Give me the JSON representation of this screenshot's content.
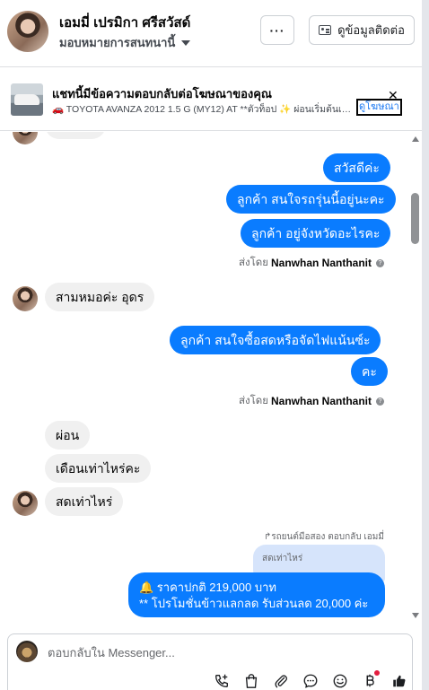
{
  "header": {
    "contact_name": "เอมมี่ เปรมิกา ศรีสวัสด์",
    "assign_label": "มอบหมายการสนทนานี้",
    "more_label": "···",
    "contact_info_label": "ดูข้อมูลติดต่อ"
  },
  "ad": {
    "title": "แชทนี้มีข้อความตอบกลับต่อโฆษณาของคุณ",
    "subtitle": "🚗 TOYOTA AVANZA 2012 1.5 G (MY12) AT **ตัวท็อป ✨ ผ่อนเริ่มต้นเพ็...",
    "view_ad_label": "ดูโฆษณา",
    "close_label": "✕"
  },
  "messages": {
    "m1": "สวัสดีค่ะ",
    "m2": "ลูกค้า สนใจรถรุ่นนี้อยู่นะคะ",
    "m3": "ลูกค้า อยู่จังหวัดอะไรคะ",
    "sent_by_1_prefix": "ส่งโดย",
    "sent_by_1_name": "Nanwhan Nanthanit",
    "m4": "สามหมอค่ะ อุดร",
    "m5": "ลูกค้า สนใจซื้อสดหรือจัดไฟแน้นซ์ะ",
    "m6": "คะ",
    "sent_by_2_prefix": "ส่งโดย",
    "sent_by_2_name": "Nanwhan Nanthanit",
    "m7": "ผ่อน",
    "m8": "เดือนเท่าไหร่คะ",
    "m9": "สดเท่าไหร่",
    "reply_hint": "↱รถยนต์มือสอง ตอบกลับ เอมมี่",
    "quoted_text": "สดเท่าไหร่",
    "m10_line1": "🔔 ราคาปกติ 219,000 บาท",
    "m10_line2": "** โปรโมชั่นข้าวแลกลด รับส่วนลด 20,000 ค่ะ"
  },
  "composer": {
    "placeholder": "ตอบกลับใน Messenger..."
  },
  "icons": [
    "call-add-icon",
    "shopping-bag-icon",
    "paperclip-icon",
    "chat-bubble-icon",
    "emoji-icon",
    "baht-payment-icon",
    "thumbs-up-icon"
  ],
  "colors": {
    "outgoing_bubble": "#0a7cff",
    "incoming_bubble": "#f0f0f0",
    "quoted_bubble": "#d6e4fb",
    "notification_dot": "#e41e3f"
  }
}
